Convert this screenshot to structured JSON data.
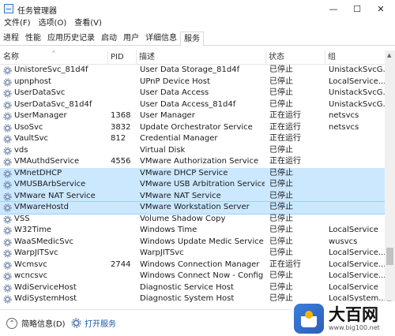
{
  "window": {
    "title": "任务管理器",
    "minimize_glyph": "—",
    "maximize_glyph": "☐",
    "close_glyph": "✕"
  },
  "menu": [
    "文件(F)",
    "选项(O)",
    "查看(V)"
  ],
  "tabs": [
    {
      "label": "进程"
    },
    {
      "label": "性能"
    },
    {
      "label": "应用历史记录"
    },
    {
      "label": "启动"
    },
    {
      "label": "用户"
    },
    {
      "label": "详细信息"
    },
    {
      "label": "服务",
      "active": true
    }
  ],
  "table": {
    "columns": [
      "名称",
      "PID",
      "描述",
      "状态",
      "组"
    ],
    "rows": [
      {
        "name": "UnistoreSvc_81d4f",
        "pid": "",
        "desc": "User Data Storage_81d4f",
        "status": "已停止",
        "group": "UnistackSvcG..."
      },
      {
        "name": "upnphost",
        "pid": "",
        "desc": "UPnP Device Host",
        "status": "已停止",
        "group": "LocalService..."
      },
      {
        "name": "UserDataSvc",
        "pid": "",
        "desc": "User Data Access",
        "status": "已停止",
        "group": "UnistackSvcG..."
      },
      {
        "name": "UserDataSvc_81d4f",
        "pid": "",
        "desc": "User Data Access_81d4f",
        "status": "已停止",
        "group": "UnistackSvcG..."
      },
      {
        "name": "UserManager",
        "pid": "1368",
        "desc": "User Manager",
        "status": "正在运行",
        "group": "netsvcs"
      },
      {
        "name": "UsoSvc",
        "pid": "3832",
        "desc": "Update Orchestrator Service",
        "status": "正在运行",
        "group": "netsvcs"
      },
      {
        "name": "VaultSvc",
        "pid": "812",
        "desc": "Credential Manager",
        "status": "正在运行",
        "group": ""
      },
      {
        "name": "vds",
        "pid": "",
        "desc": "Virtual Disk",
        "status": "已停止",
        "group": ""
      },
      {
        "name": "VMAuthdService",
        "pid": "4556",
        "desc": "VMware Authorization Service",
        "status": "正在运行",
        "group": ""
      },
      {
        "name": "VMnetDHCP",
        "pid": "",
        "desc": "VMware DHCP Service",
        "status": "已停止",
        "group": "",
        "selected": true
      },
      {
        "name": "VMUSBArbService",
        "pid": "",
        "desc": "VMware USB Arbitration Service",
        "status": "已停止",
        "group": "",
        "selected": true
      },
      {
        "name": "VMware NAT Service",
        "pid": "",
        "desc": "VMware NAT Service",
        "status": "已停止",
        "group": "",
        "selected": true
      },
      {
        "name": "VMwareHostd",
        "pid": "",
        "desc": "VMware Workstation Server",
        "status": "已停止",
        "group": "",
        "selected": true,
        "focused": true
      },
      {
        "name": "VSS",
        "pid": "",
        "desc": "Volume Shadow Copy",
        "status": "已停止",
        "group": ""
      },
      {
        "name": "W32Time",
        "pid": "",
        "desc": "Windows Time",
        "status": "已停止",
        "group": "LocalService"
      },
      {
        "name": "WaaSMedicSvc",
        "pid": "",
        "desc": "Windows Update Medic Service",
        "status": "已停止",
        "group": "wusvcs"
      },
      {
        "name": "WarpJITSvc",
        "pid": "",
        "desc": "WarpJITSvc",
        "status": "已停止",
        "group": "LocalService..."
      },
      {
        "name": "Wcmsvc",
        "pid": "2744",
        "desc": "Windows Connection Manager",
        "status": "正在运行",
        "group": "LocalService..."
      },
      {
        "name": "wcncsvc",
        "pid": "",
        "desc": "Windows Connect Now - Config R...",
        "status": "已停止",
        "group": "LocalService..."
      },
      {
        "name": "WdiServiceHost",
        "pid": "",
        "desc": "Diagnostic Service Host",
        "status": "已停止",
        "group": "LocalService"
      },
      {
        "name": "WdiSystemHost",
        "pid": "",
        "desc": "Diagnostic System Host",
        "status": "已停止",
        "group": "LocalSystem..."
      }
    ]
  },
  "footer": {
    "summary_label": "简略信息(D)",
    "open_services_label": "打开服务",
    "summary_glyph": "⌃"
  },
  "watermark": {
    "title": "大百网",
    "url": "www.big100.net"
  },
  "colors": {
    "selection": "#cce8ff",
    "link": "#1a5aa6"
  }
}
